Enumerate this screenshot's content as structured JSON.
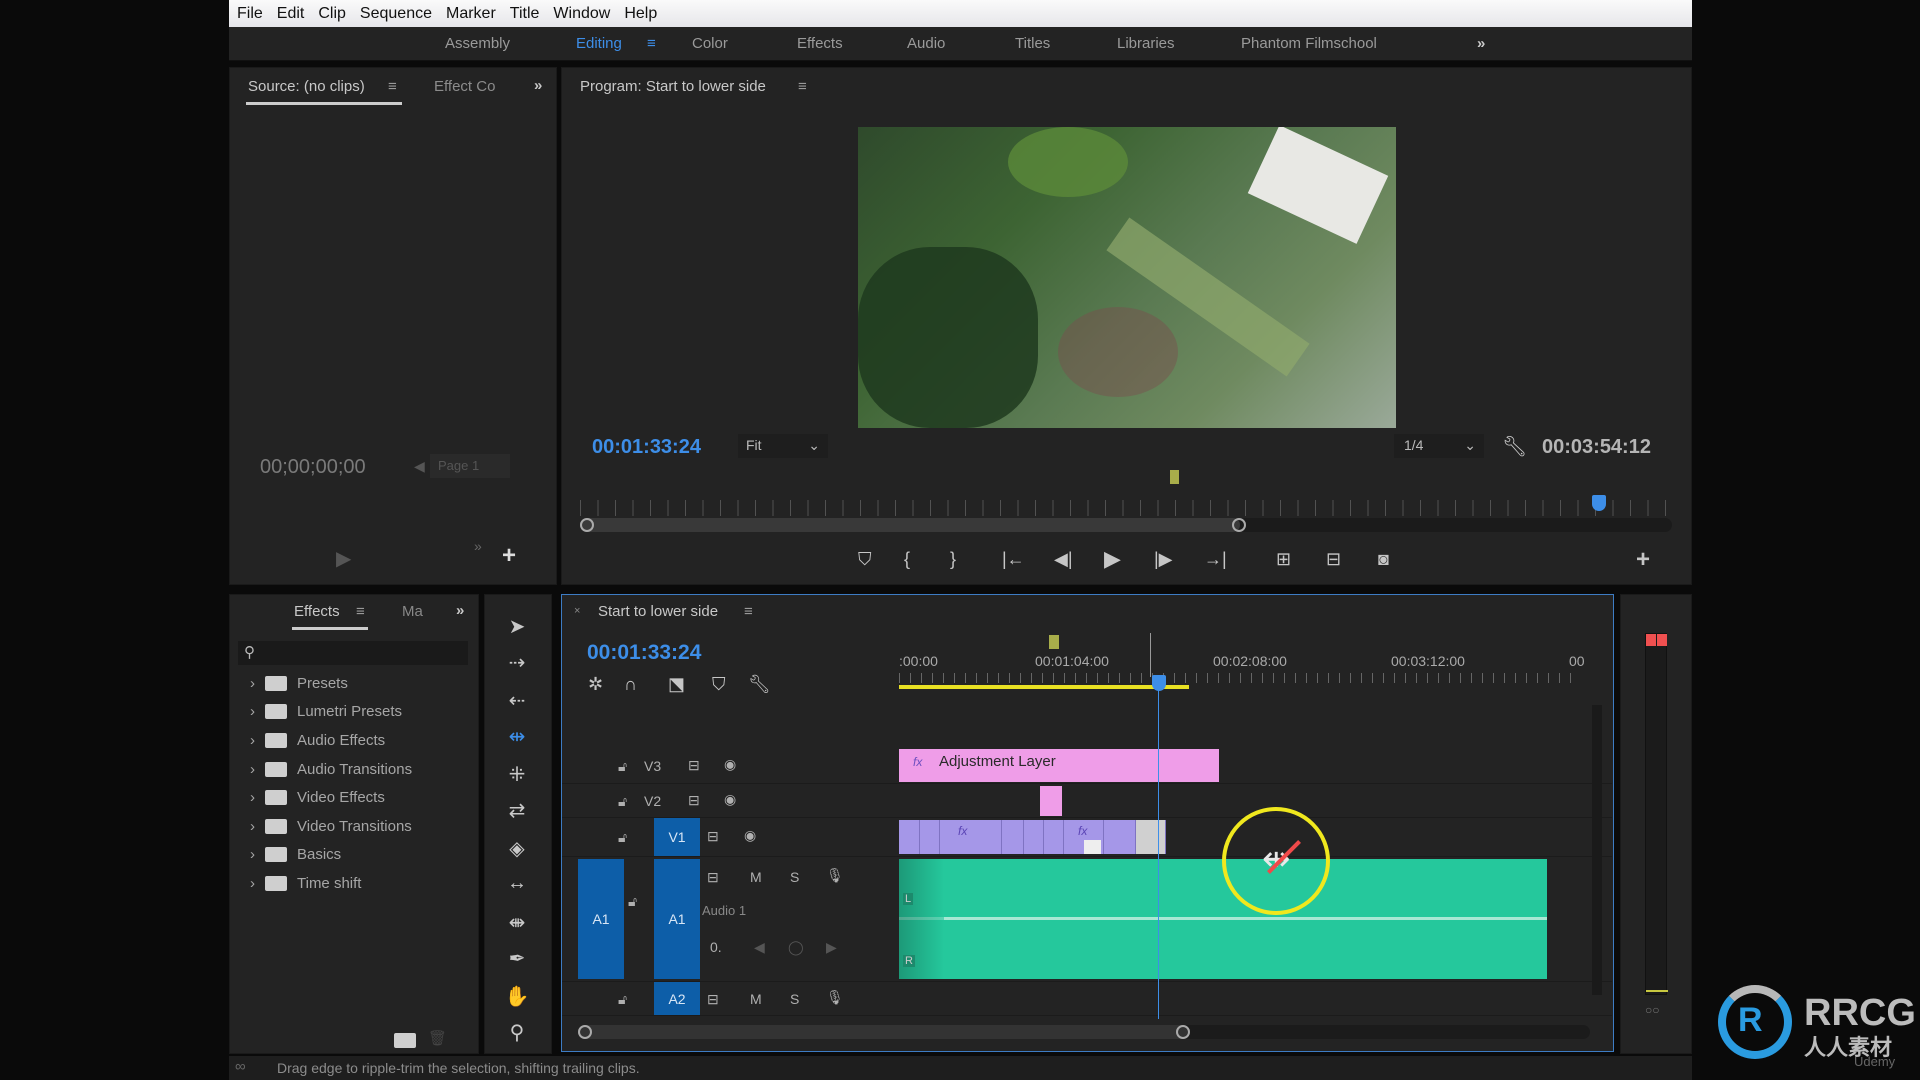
{
  "menu": [
    "File",
    "Edit",
    "Clip",
    "Sequence",
    "Marker",
    "Title",
    "Window",
    "Help"
  ],
  "workspaces": {
    "items": [
      "Assembly",
      "Editing",
      "Color",
      "Effects",
      "Audio",
      "Titles",
      "Libraries",
      "Phantom Filmschool"
    ],
    "active": "Editing",
    "overflow": "»"
  },
  "source": {
    "tab": "Source: (no clips)",
    "tab2": "Effect Co",
    "timecode": "00;00;00;00",
    "page": "Page 1"
  },
  "program": {
    "tab": "Program: Start to lower side",
    "timecode": "00:01:33:24",
    "fit": "Fit",
    "resolution": "1/4",
    "duration": "00:03:54:12"
  },
  "effects": {
    "tab": "Effects",
    "tab2": "Ma",
    "search_placeholder": "",
    "items": [
      "Presets",
      "Lumetri Presets",
      "Audio Effects",
      "Audio Transitions",
      "Video Effects",
      "Video Transitions",
      "Basics",
      "Time shift"
    ]
  },
  "timeline": {
    "tab": "Start to lower side",
    "timecode": "00:01:33:24",
    "ruler": [
      ":00:00",
      "00:01:04:00",
      "00:02:08:00",
      "00:03:12:00",
      "00"
    ],
    "tracks": {
      "v3": "V3",
      "v2": "V2",
      "v1": "V1",
      "a1_src": "A1",
      "a1": "A1",
      "a1_name": "Audio 1",
      "a2": "A2",
      "m": "M",
      "s": "S",
      "vol": "0."
    },
    "adjustment_label": "Adjustment Layer",
    "fx": "fx",
    "ch_l": "L",
    "ch_r": "R"
  },
  "status": "Drag edge to ripple-trim the selection, shifting trailing clips.",
  "watermark": {
    "brand": "RRCG",
    "sub": "人人素材",
    "udemy": "Udemy"
  },
  "colors": {
    "accent": "#3d8ee8",
    "adjustment": "#ef9de8",
    "video_clip": "#a597e8",
    "audio_clip": "#25c89c",
    "highlight": "#f0e81e"
  }
}
